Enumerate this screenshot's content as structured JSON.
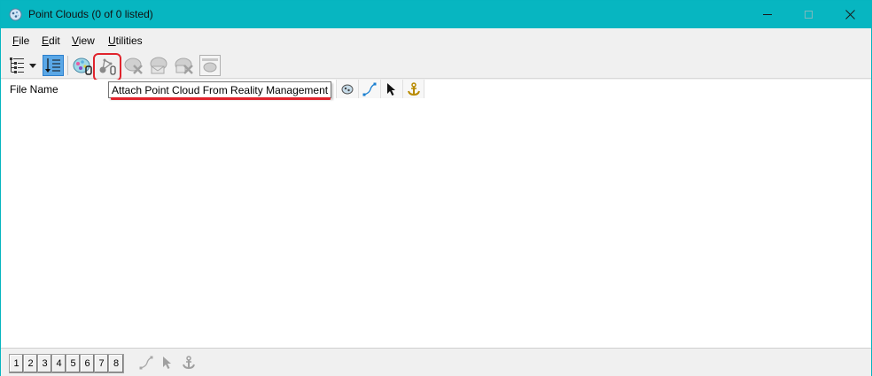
{
  "window": {
    "title": "Point Clouds (0 of 0 listed)",
    "accent_color": "#07b6c1",
    "controls": [
      "minimize-icon",
      "maximize-icon",
      "close-icon"
    ]
  },
  "menu": {
    "items": [
      {
        "label_u": "F",
        "label_rest": "ile"
      },
      {
        "label_u": "E",
        "label_rest": "dit"
      },
      {
        "label_u": "V",
        "label_rest": "iew"
      },
      {
        "label_u": "U",
        "label_rest": "tilities"
      }
    ]
  },
  "toolbar": {
    "buttons": [
      {
        "icon": "tree-list-icon",
        "enabled": true
      },
      {
        "icon": "dropdown-arrow-icon",
        "enabled": true
      },
      {
        "icon": "sort-list-icon",
        "enabled": true,
        "active": true
      },
      {
        "icon": "attach-point-cloud-icon",
        "enabled": true
      },
      {
        "icon": "attach-reality-management-icon",
        "enabled": true,
        "highlighted": true
      },
      {
        "icon": "detach-point-cloud-icon",
        "enabled": false
      },
      {
        "icon": "save-point-cloud-icon",
        "enabled": false
      },
      {
        "icon": "delete-point-cloud-icon",
        "enabled": false
      },
      {
        "icon": "point-cloud-properties-icon",
        "enabled": false
      }
    ],
    "highlight_color": "#e0242d"
  },
  "tooltip": {
    "text": "Attach Point Cloud From Reality Management"
  },
  "list": {
    "columns": {
      "file_name": "File Name"
    },
    "column_icons": [
      "display-icon",
      "snap-icon",
      "locate-icon",
      "anchor-icon"
    ],
    "rows": []
  },
  "status": {
    "view_buttons": [
      "1",
      "2",
      "3",
      "4",
      "5",
      "6",
      "7",
      "8"
    ],
    "icons": [
      "snap-icon",
      "locate-icon",
      "anchor-icon"
    ]
  }
}
